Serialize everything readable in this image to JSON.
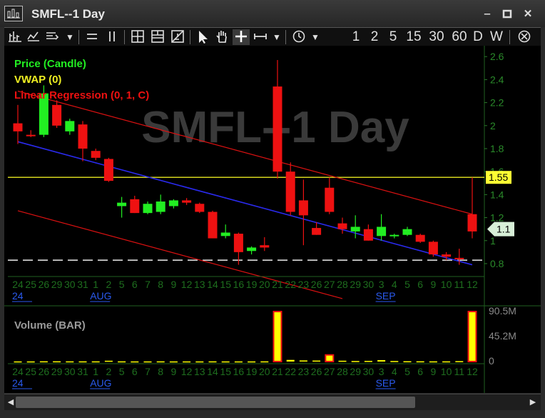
{
  "window": {
    "title": "SMFL--1 Day",
    "minimize_glyph": "‒",
    "restore_glyph": "▫",
    "close_glyph": "✕"
  },
  "toolbar": {
    "intervals": [
      "1",
      "2",
      "5",
      "15",
      "30",
      "60",
      "D",
      "W"
    ]
  },
  "chart": {
    "watermark": "SMFL--1 Day",
    "legend": [
      {
        "label": "Price (Candle)",
        "color": "#22ee22"
      },
      {
        "label": "VWAP (0)",
        "color": "#eeee22"
      },
      {
        "label": "Linear Regression (0, 1, C)",
        "color": "#ee1111"
      }
    ],
    "price_axis_ticks": [
      "2.6",
      "2.4",
      "2.2",
      "2",
      "1.8",
      "1.6",
      "1.4",
      "1.2",
      "1",
      "0.8"
    ],
    "vwap_tag": "1.55",
    "last_price_tag": "1.1",
    "volume_label": "Volume (BAR)",
    "volume_axis_ticks": [
      "90.5M",
      "45.2M",
      "0"
    ],
    "date_labels": [
      "24",
      "25",
      "26",
      "29",
      "30",
      "31",
      "1",
      "2",
      "5",
      "6",
      "7",
      "8",
      "9",
      "12",
      "13",
      "14",
      "15",
      "16",
      "19",
      "20",
      "21",
      "22",
      "23",
      "26",
      "27",
      "28",
      "29",
      "30",
      "3",
      "4",
      "5",
      "6",
      "9",
      "10",
      "11",
      "12"
    ],
    "month_labels": [
      {
        "text": "24",
        "index": 0
      },
      {
        "text": "AUG",
        "index": 6
      },
      {
        "text": "SEP",
        "index": 28
      }
    ]
  },
  "chart_data": {
    "type": "candlestick",
    "title": "SMFL--1 Day",
    "ylim": [
      0.75,
      2.62
    ],
    "vwap": 1.55,
    "last": 1.1,
    "regression": {
      "start": 1.86,
      "end": 0.79,
      "upper_offset": 0.44,
      "lower_offset": -0.6
    },
    "dashed_level": 0.83,
    "candles": [
      {
        "o": 2.02,
        "h": 2.18,
        "l": 1.84,
        "c": 1.95
      },
      {
        "o": 1.92,
        "h": 1.96,
        "l": 1.9,
        "c": 1.91
      },
      {
        "o": 1.92,
        "h": 2.35,
        "l": 1.9,
        "c": 2.28
      },
      {
        "o": 2.18,
        "h": 2.22,
        "l": 1.98,
        "c": 2.0
      },
      {
        "o": 1.95,
        "h": 2.06,
        "l": 1.92,
        "c": 2.04
      },
      {
        "o": 2.01,
        "h": 2.04,
        "l": 1.69,
        "c": 1.8
      },
      {
        "o": 1.78,
        "h": 1.8,
        "l": 1.7,
        "c": 1.72
      },
      {
        "o": 1.71,
        "h": 1.72,
        "l": 1.51,
        "c": 1.52
      },
      {
        "o": 1.3,
        "h": 1.38,
        "l": 1.2,
        "c": 1.33
      },
      {
        "o": 1.36,
        "h": 1.39,
        "l": 1.24,
        "c": 1.24
      },
      {
        "o": 1.24,
        "h": 1.34,
        "l": 1.23,
        "c": 1.32
      },
      {
        "o": 1.25,
        "h": 1.4,
        "l": 1.23,
        "c": 1.34
      },
      {
        "o": 1.3,
        "h": 1.36,
        "l": 1.28,
        "c": 1.35
      },
      {
        "o": 1.35,
        "h": 1.37,
        "l": 1.31,
        "c": 1.33
      },
      {
        "o": 1.32,
        "h": 1.33,
        "l": 1.24,
        "c": 1.25
      },
      {
        "o": 1.25,
        "h": 1.26,
        "l": 1.02,
        "c": 1.02
      },
      {
        "o": 1.04,
        "h": 1.14,
        "l": 1.02,
        "c": 1.07
      },
      {
        "o": 1.06,
        "h": 1.07,
        "l": 0.79,
        "c": 0.9
      },
      {
        "o": 0.91,
        "h": 0.95,
        "l": 0.88,
        "c": 0.94
      },
      {
        "o": 0.96,
        "h": 1.03,
        "l": 0.91,
        "c": 0.94
      },
      {
        "o": 2.34,
        "h": 2.57,
        "l": 1.54,
        "c": 1.6
      },
      {
        "o": 1.6,
        "h": 1.68,
        "l": 1.22,
        "c": 1.25
      },
      {
        "o": 1.35,
        "h": 1.53,
        "l": 0.96,
        "c": 1.22
      },
      {
        "o": 1.11,
        "h": 1.16,
        "l": 1.05,
        "c": 1.05
      },
      {
        "o": 1.46,
        "h": 1.55,
        "l": 1.23,
        "c": 1.25
      },
      {
        "o": 1.15,
        "h": 1.2,
        "l": 1.06,
        "c": 1.1
      },
      {
        "o": 1.08,
        "h": 1.22,
        "l": 1.02,
        "c": 1.12
      },
      {
        "o": 1.1,
        "h": 1.14,
        "l": 1.0,
        "c": 1.0
      },
      {
        "o": 1.04,
        "h": 1.23,
        "l": 1.0,
        "c": 1.12
      },
      {
        "o": 1.05,
        "h": 1.06,
        "l": 1.02,
        "c": 1.05
      },
      {
        "o": 1.05,
        "h": 1.12,
        "l": 1.04,
        "c": 1.1
      },
      {
        "o": 1.05,
        "h": 1.06,
        "l": 0.98,
        "c": 0.99
      },
      {
        "o": 0.99,
        "h": 1.0,
        "l": 0.86,
        "c": 0.88
      },
      {
        "o": 0.88,
        "h": 0.9,
        "l": 0.83,
        "c": 0.86
      },
      {
        "o": 0.85,
        "h": 0.93,
        "l": 0.79,
        "c": 0.84
      },
      {
        "o": 1.23,
        "h": 1.55,
        "l": 1.02,
        "c": 1.08
      }
    ],
    "volume_series": {
      "name": "Volume (BAR)",
      "unit": "M",
      "ylim": [
        0,
        90.5
      ],
      "values": [
        0.3,
        0.3,
        0.5,
        0.5,
        0.4,
        0.4,
        0.4,
        1.5,
        0.4,
        0.3,
        0.3,
        0.4,
        0.3,
        0.3,
        0.3,
        0.4,
        0.3,
        0.3,
        0.3,
        0.4,
        90.5,
        3.0,
        2.0,
        1.8,
        12.0,
        1.5,
        1.0,
        1.2,
        2.5,
        1.0,
        0.6,
        0.5,
        0.4,
        0.4,
        0.8,
        90.5
      ]
    }
  }
}
